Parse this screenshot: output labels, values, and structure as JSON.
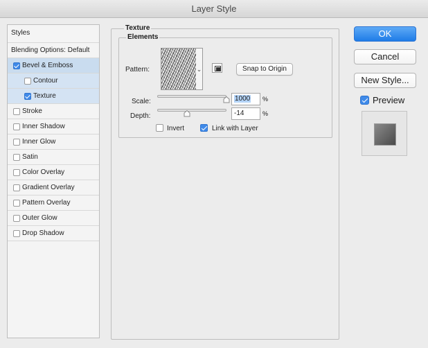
{
  "window": {
    "title": "Layer Style"
  },
  "styles_panel": {
    "header": "Styles",
    "items": [
      {
        "label": "Blending Options: Default",
        "checkbox": false,
        "checked": false,
        "indent": false,
        "selected": false
      },
      {
        "label": "Bevel & Emboss",
        "checkbox": true,
        "checked": true,
        "indent": false,
        "selected": true
      },
      {
        "label": "Contour",
        "checkbox": true,
        "checked": false,
        "indent": true,
        "selected": true
      },
      {
        "label": "Texture",
        "checkbox": true,
        "checked": true,
        "indent": true,
        "selected": true
      },
      {
        "label": "Stroke",
        "checkbox": true,
        "checked": false,
        "indent": false,
        "selected": false
      },
      {
        "label": "Inner Shadow",
        "checkbox": true,
        "checked": false,
        "indent": false,
        "selected": false
      },
      {
        "label": "Inner Glow",
        "checkbox": true,
        "checked": false,
        "indent": false,
        "selected": false
      },
      {
        "label": "Satin",
        "checkbox": true,
        "checked": false,
        "indent": false,
        "selected": false
      },
      {
        "label": "Color Overlay",
        "checkbox": true,
        "checked": false,
        "indent": false,
        "selected": false
      },
      {
        "label": "Gradient Overlay",
        "checkbox": true,
        "checked": false,
        "indent": false,
        "selected": false
      },
      {
        "label": "Pattern Overlay",
        "checkbox": true,
        "checked": false,
        "indent": false,
        "selected": false
      },
      {
        "label": "Outer Glow",
        "checkbox": true,
        "checked": false,
        "indent": false,
        "selected": false
      },
      {
        "label": "Drop Shadow",
        "checkbox": true,
        "checked": false,
        "indent": false,
        "selected": false
      }
    ]
  },
  "texture": {
    "section_title": "Texture",
    "group_title": "Elements",
    "pattern_label": "Pattern:",
    "pattern_arrow": "⌄",
    "snap_button": "Snap to Origin",
    "scale_label": "Scale:",
    "scale_value": "1000",
    "scale_slider": 1.0,
    "depth_label": "Depth:",
    "depth_value": "-14",
    "depth_slider": 0.43,
    "percent": "%",
    "invert_label": "Invert",
    "invert_checked": false,
    "link_label": "Link with Layer",
    "link_checked": true
  },
  "buttons": {
    "ok": "OK",
    "cancel": "Cancel",
    "new_style": "New Style..."
  },
  "preview": {
    "label": "Preview",
    "checked": true
  }
}
